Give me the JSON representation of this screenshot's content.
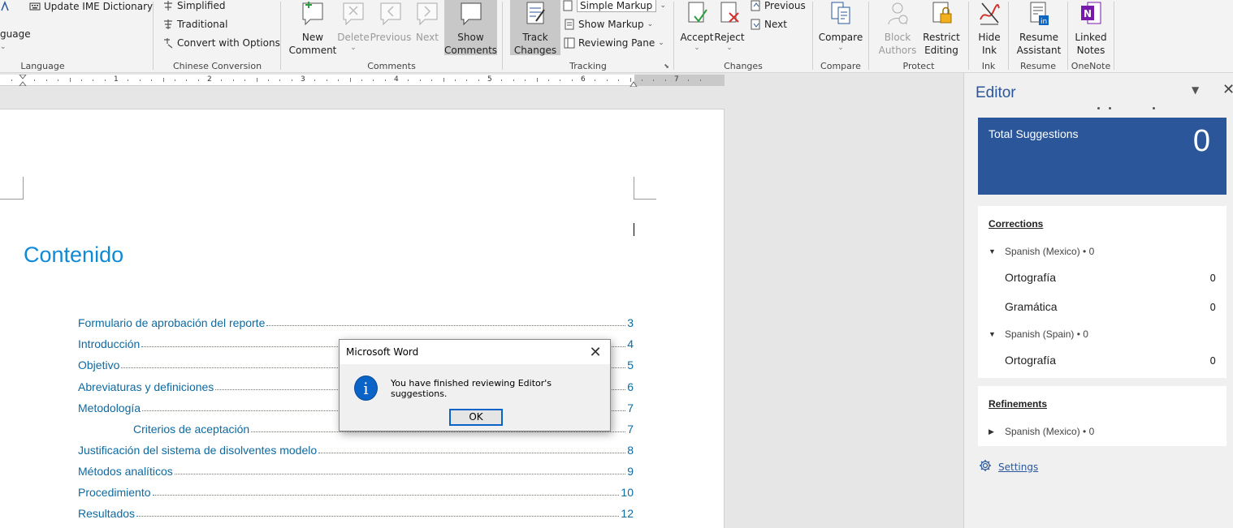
{
  "ribbon": {
    "language_group": {
      "update_ime": "Update IME Dictionary",
      "language_btn": "guage",
      "label": "Language"
    },
    "chinese_group": {
      "simplified": "Simplified",
      "traditional": "Traditional",
      "convert": "Convert with Options",
      "label": "Chinese Conversion"
    },
    "comments_group": {
      "new_comment_1": "New",
      "new_comment_2": "Comment",
      "delete": "Delete",
      "previous": "Previous",
      "next": "Next",
      "show_comments_1": "Show",
      "show_comments_2": "Comments",
      "label": "Comments"
    },
    "tracking_group": {
      "track_changes_1": "Track",
      "track_changes_2": "Changes",
      "simple_markup": "Simple Markup",
      "show_markup": "Show Markup",
      "reviewing_pane": "Reviewing Pane",
      "label": "Tracking"
    },
    "changes_group": {
      "accept": "Accept",
      "reject": "Reject",
      "previous": "Previous",
      "next": "Next",
      "label": "Changes"
    },
    "compare_group": {
      "compare": "Compare",
      "label": "Compare"
    },
    "protect_group": {
      "block_1": "Block",
      "block_2": "Authors",
      "restrict_1": "Restrict",
      "restrict_2": "Editing",
      "label": "Protect"
    },
    "ink_group": {
      "hide_1": "Hide",
      "hide_2": "Ink",
      "label": "Ink"
    },
    "resume_group": {
      "resume_1": "Resume",
      "resume_2": "Assistant",
      "label": "Resume"
    },
    "onenote_group": {
      "linked_1": "Linked",
      "linked_2": "Notes",
      "label": "OneNote"
    }
  },
  "ruler": {
    "numbers": [
      "1",
      "2",
      "3",
      "4",
      "5",
      "6",
      "7"
    ]
  },
  "document": {
    "toc_title": "Contenido",
    "toc": [
      {
        "text": "Formulario de aprobación del reporte",
        "page": "3"
      },
      {
        "text": "Introducción",
        "page": "4"
      },
      {
        "text": "Objetivo",
        "page": "5"
      },
      {
        "text": "Abreviaturas y definiciones",
        "page": "6"
      },
      {
        "text": "Metodología",
        "page": "7"
      },
      {
        "text": "Criterios de aceptación",
        "page": "7"
      },
      {
        "text": "Justificación del sistema de disolventes modelo",
        "page": "8"
      },
      {
        "text": "Métodos analíticos",
        "page": "9"
      },
      {
        "text": "Procedimiento",
        "page": "10"
      },
      {
        "text": "Resultados",
        "page": "12"
      }
    ]
  },
  "dialog": {
    "title": "Microsoft Word",
    "message": "You have finished reviewing Editor's suggestions.",
    "ok": "OK"
  },
  "editor": {
    "title": "Editor",
    "total_label": "Total Suggestions",
    "total_value": "0",
    "corrections_title": "Corrections",
    "lang_mx": "Spanish (Mexico) • 0",
    "ortografia": "Ortografía",
    "ortografia_count": "0",
    "gramatica": "Gramática",
    "gramatica_count": "0",
    "lang_es": "Spanish (Spain) • 0",
    "ortografia_es": "Ortografía",
    "ortografia_es_count": "0",
    "refinements_title": "Refinements",
    "ref_lang_mx": "Spanish (Mexico) • 0",
    "settings": "Settings"
  },
  "colors": {
    "accent": "#2b579a",
    "heading": "#0f8ad4",
    "toc_link": "#0c6aa3"
  }
}
